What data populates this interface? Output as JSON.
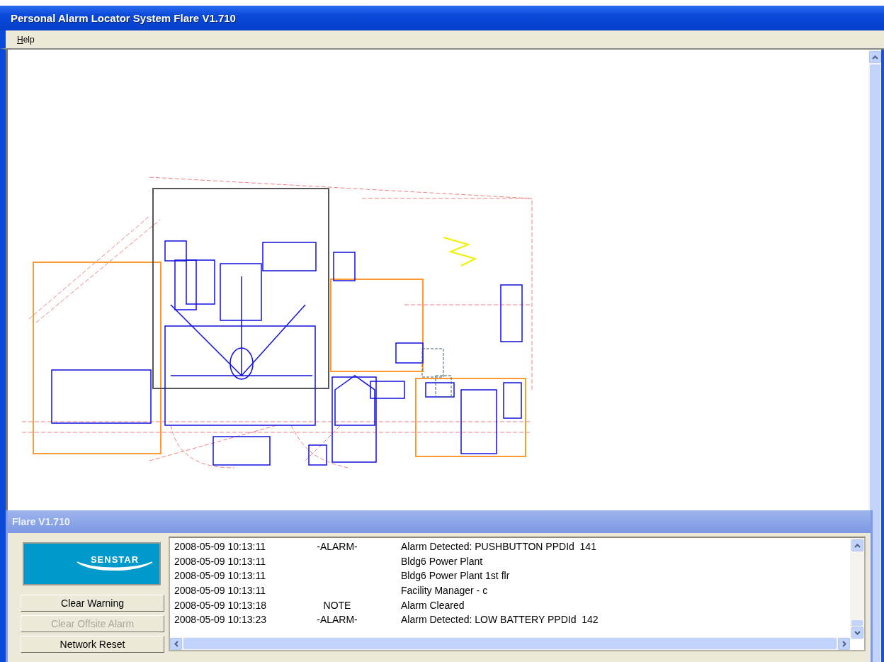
{
  "window": {
    "title": "Personal Alarm Locator System Flare V1.710"
  },
  "menu": [
    {
      "label": "Help"
    }
  ],
  "dialog": {
    "title": "Flare V1.710",
    "logo": "SENSTAR",
    "buttons": [
      {
        "label": "Clear Warning",
        "disabled": false
      },
      {
        "label": "Clear Offsite Alarm",
        "disabled": true
      },
      {
        "label": "Network Reset",
        "disabled": false
      }
    ],
    "log": [
      {
        "time": "2008-05-09 10:13:11",
        "type": "-ALARM-",
        "message": "Alarm Detected: PUSHBUTTON PPDId  141"
      },
      {
        "time": "2008-05-09 10:13:11",
        "message": "Bldg6 Power Plant"
      },
      {
        "time": "2008-05-09 10:13:11",
        "message": "Bldg6 Power Plant 1st flr"
      },
      {
        "time": "2008-05-09 10:13:11",
        "message": "Facility Manager - c"
      },
      {
        "time": "2008-05-09 10:13:18",
        "type": "NOTE",
        "message": "Alarm Cleared"
      },
      {
        "time": "2008-05-09 10:13:23",
        "type": "-ALARM-",
        "message": "Alarm Detected: LOW BATTERY PPDId  142"
      }
    ]
  }
}
